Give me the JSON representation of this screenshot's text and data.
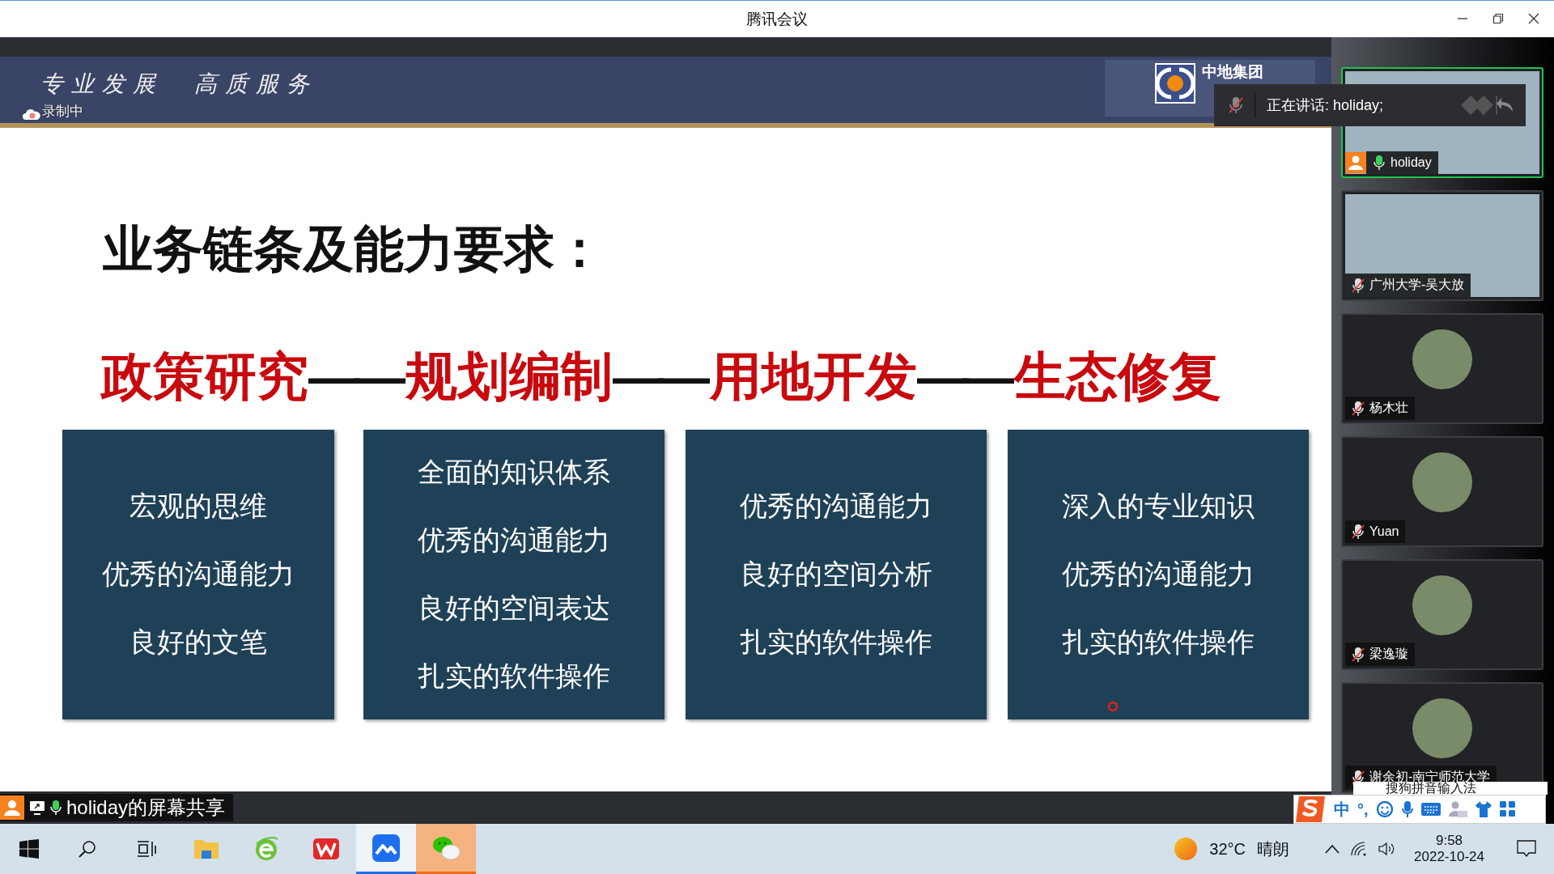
{
  "window": {
    "title": "腾讯会议"
  },
  "slide": {
    "banner_slogan": "专业发展　高质服务",
    "recording_label": "录制中",
    "logo_text": "中地集团",
    "title": "业务链条及能力要求：",
    "chain": [
      {
        "label": "政策研究",
        "skills": [
          "宏观的思维",
          "优秀的沟通能力",
          "良好的文笔"
        ]
      },
      {
        "label": "规划编制",
        "skills": [
          "全面的知识体系",
          "优秀的沟通能力",
          "良好的空间表达",
          "扎实的软件操作"
        ]
      },
      {
        "label": "用地开发",
        "skills": [
          "优秀的沟通能力",
          "良好的空间分析",
          "扎实的软件操作"
        ]
      },
      {
        "label": "生态修复",
        "skills": [
          "深入的专业知识",
          "优秀的沟通能力",
          "扎实的软件操作"
        ]
      }
    ],
    "chain_separator": "——"
  },
  "speaking_tip": {
    "text": "正在讲话: holiday;"
  },
  "participants": [
    {
      "name": "holiday",
      "kind": "video",
      "muted": false,
      "selected": true,
      "host": true
    },
    {
      "name": "广州大学-吴大放",
      "kind": "video",
      "muted": true,
      "selected": false,
      "host": false
    },
    {
      "name": "杨木壮",
      "kind": "avatar",
      "muted": true,
      "selected": false,
      "host": false
    },
    {
      "name": "Yuan",
      "kind": "avatar",
      "muted": true,
      "selected": false,
      "host": false
    },
    {
      "name": "梁逸璇",
      "kind": "avatar",
      "muted": true,
      "selected": false,
      "host": false
    },
    {
      "name": "谢余初-南宁师范大学",
      "kind": "avatar",
      "muted": true,
      "selected": false,
      "host": false
    }
  ],
  "share_bar": {
    "label": "holiday的屏幕共享"
  },
  "ime": {
    "window_title": "搜狗拼音输入法",
    "mode": "中",
    "punct": "°,"
  },
  "taskbar": {
    "weather_temp": "32°C",
    "weather_text": "晴朗",
    "time": "9:58",
    "date": "2022-10-24",
    "apps": [
      {
        "kind": "explorer",
        "selected": false
      },
      {
        "kind": "browser",
        "selected": false
      },
      {
        "kind": "office",
        "selected": false
      },
      {
        "kind": "meeting",
        "selected": true
      },
      {
        "kind": "chat",
        "selected": false
      }
    ]
  }
}
